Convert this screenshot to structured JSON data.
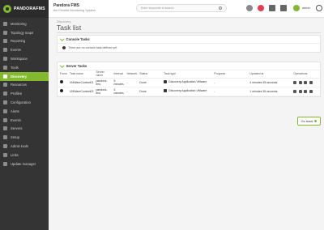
{
  "brand": {
    "logo_text": "PANDORAFMS"
  },
  "header": {
    "app_title": "Pandora FMS",
    "app_subtitle": "the Flexible Monitoring System",
    "search_placeholder": "Enter keywords to search",
    "user_name": "admin"
  },
  "sidebar": {
    "items": [
      {
        "label": "Monitoring",
        "icon": "monitor-icon",
        "active": false
      },
      {
        "label": "Topology maps",
        "icon": "topology-icon",
        "active": false
      },
      {
        "label": "Reporting",
        "icon": "report-icon",
        "active": false
      },
      {
        "label": "Events",
        "icon": "events-icon",
        "active": false
      },
      {
        "label": "Workspace",
        "icon": "workspace-icon",
        "active": false
      },
      {
        "label": "Tools",
        "icon": "tools-icon",
        "active": false
      },
      {
        "label": "Discovery",
        "icon": "discovery-icon",
        "active": true
      },
      {
        "label": "Resources",
        "icon": "resources-icon",
        "active": false
      },
      {
        "label": "Profiles",
        "icon": "profiles-icon",
        "active": false
      },
      {
        "label": "Configuration",
        "icon": "config-icon",
        "active": false
      },
      {
        "label": "Alerts",
        "icon": "alerts-icon",
        "active": false
      },
      {
        "label": "Events",
        "icon": "events-icon",
        "active": false
      },
      {
        "label": "Servers",
        "icon": "servers-icon",
        "active": false
      },
      {
        "label": "Setup",
        "icon": "setup-icon",
        "active": false
      },
      {
        "label": "Admin tools",
        "icon": "admin-icon",
        "active": false
      },
      {
        "label": "Links",
        "icon": "links-icon",
        "active": false
      },
      {
        "label": "Update manager",
        "icon": "update-icon",
        "active": false
      }
    ]
  },
  "main": {
    "breadcrumb": "Discovery",
    "title": "Task list",
    "console_tasks": {
      "heading": "Console Tasks",
      "empty_message": "There are no console task defined yet."
    },
    "server_tasks": {
      "heading": "Server Tasks",
      "columns": [
        "Force",
        "Task name",
        "Server name",
        "Interval",
        "Network",
        "Status",
        "Task type",
        "Progress",
        "Updated at",
        "Operations"
      ],
      "rows": [
        {
          "task_name": "VMWareContext01",
          "server_name": "pandora-fms",
          "interval": "5 minutes",
          "network": "-",
          "status": "Done",
          "task_type": "Discovery.Application.VMware",
          "progress": "-",
          "updated_at": "4 minutes 35 seconds"
        },
        {
          "task_name": "VMWareContext02",
          "server_name": "pandora-fms",
          "interval": "5 minutes",
          "network": "-",
          "status": "Done",
          "task_type": "Discovery.Application.VMware",
          "progress": "-",
          "updated_at": "1 minutes 36 seconds"
        }
      ]
    },
    "go_back_label": "Go back"
  },
  "colors": {
    "accent": "#82b92e",
    "sidebar": "#343434",
    "alert": "#e63c52"
  }
}
